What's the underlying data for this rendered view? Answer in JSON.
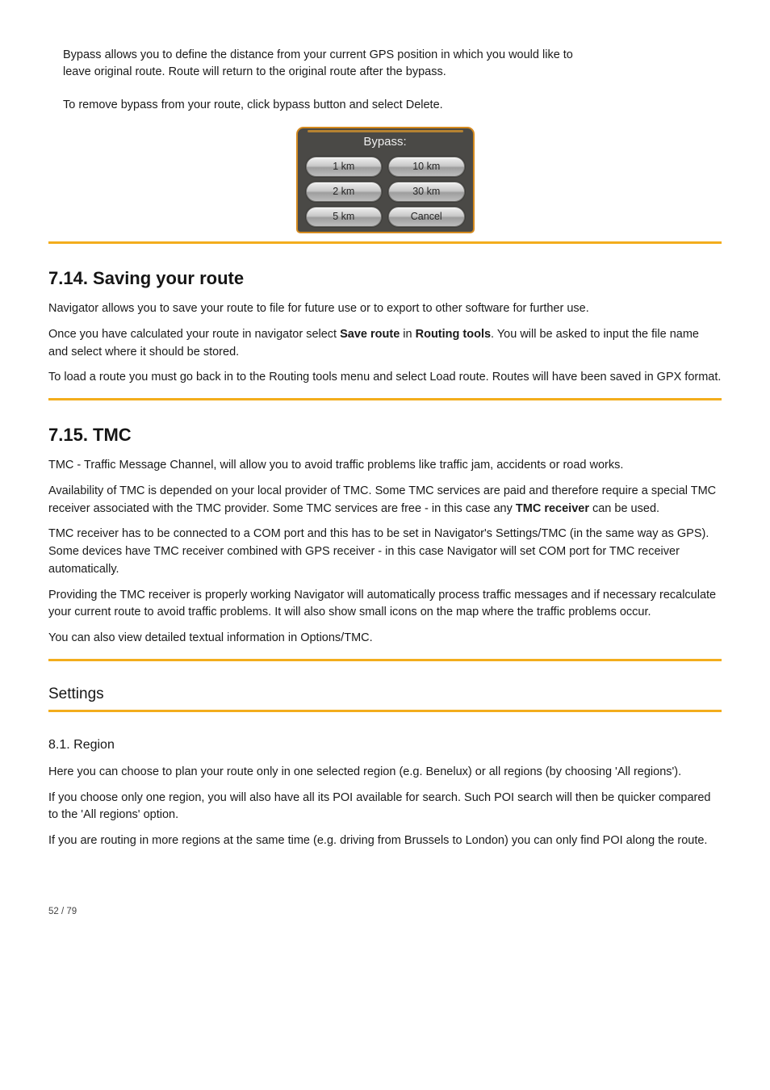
{
  "intro_line1": "Bypass allows you to define the distance from your current GPS position in which you would like to",
  "intro_line2": "leave original route. Route will return to the original route after the bypass.",
  "intro_line3": "To remove bypass from your route, click bypass button and select Delete.",
  "bypass": {
    "title": "Bypass:",
    "buttons": [
      "1 km",
      "10 km",
      "2 km",
      "30 km",
      "5 km",
      "Cancel"
    ]
  },
  "sec714_title": "7.14.  Saving your route",
  "sec714_body1": "Navigator allows you to save your route to file for future use or to export to other software for further use.",
  "sec714_body2_a": "Once you have calculated your route in navigator select ",
  "sec714_body2_b": "Save route",
  "sec714_body2_c": " in ",
  "sec714_body2_d": "Routing tools",
  "sec714_body2_e": ". You will be asked to input the file name and select where it should be stored.",
  "sec714_body3": "To load a route you must go back in to the Routing tools menu and select Load route. Routes will have been saved in GPX format.",
  "sec715_title": "7.15.  TMC",
  "sec715_intro": "TMC - Traffic Message Channel, will allow you to avoid traffic problems like traffic jam, accidents or road works.",
  "sec715_body1_a": "Availability of TMC is depended on your local provider of TMC. Some TMC services are paid and therefore require a special TMC receiver associated with the TMC provider. Some TMC services are free - in this case any ",
  "sec715_body1_b": "TMC receiver",
  "sec715_body1_c": " can be used.",
  "sec715_body2": "TMC receiver has to be connected to a COM port and this has to be set in Navigator's Settings/TMC (in the same way as GPS). Some devices have TMC receiver combined with GPS receiver - in this case Navigator will set COM port for TMC receiver automatically.",
  "sec715_body3": "Providing the TMC receiver is properly working Navigator will automatically process traffic messages and if necessary recalculate your current route to avoid traffic problems. It will also show small icons on the map where the traffic problems occur.",
  "sec715_body4": "You can also view detailed textual information in Options/TMC.",
  "sec_settings": "Settings",
  "sec81_title": "8.1.  Region",
  "sec81_body1": "Here you can choose to plan your route only in one selected region (e.g. Benelux) or all regions (by choosing 'All regions').",
  "sec81_body2": "If you choose only one region, you will also have all its POI available for search. Such POI search will then be quicker compared to the 'All regions' option.",
  "sec81_body3": "If you are routing in more regions at the same time (e.g. driving from Brussels to London) you can only find POI along the route.",
  "footer_text": "52 / 79"
}
